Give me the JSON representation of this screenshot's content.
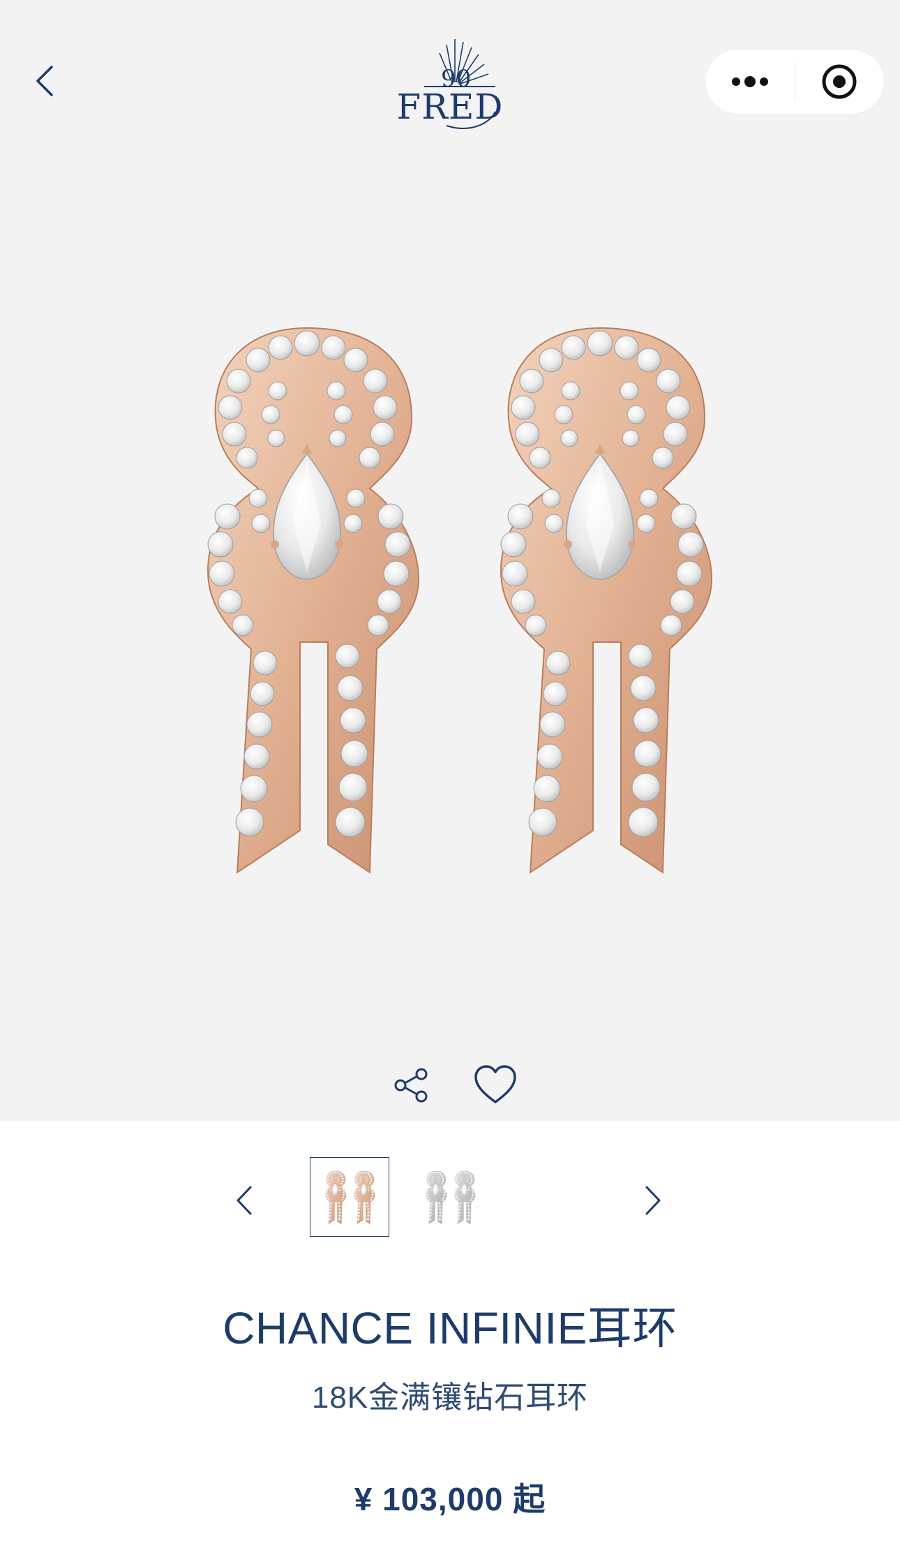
{
  "header": {
    "brand": "FRED",
    "anniversary": "90",
    "back_icon": "chevron-left-icon",
    "more_icon": "more-dots-icon",
    "close_icon": "target-close-icon"
  },
  "product": {
    "title": "CHANCE INFINIE耳环",
    "subtitle": "18K金满镶钻石耳环",
    "price": "¥ 103,000 起",
    "gallery": {
      "selected_index": 0,
      "thumbnails": [
        "rose-gold-earrings",
        "white-gold-earrings"
      ]
    }
  },
  "actions": {
    "share_icon": "share-icon",
    "favorite_icon": "heart-icon"
  },
  "colors": {
    "brand_navy": "#1d3b6b",
    "hero_bg": "#f4f3f3",
    "rose_gold": "#e7b99a",
    "diamond": "#f2f2f2"
  }
}
